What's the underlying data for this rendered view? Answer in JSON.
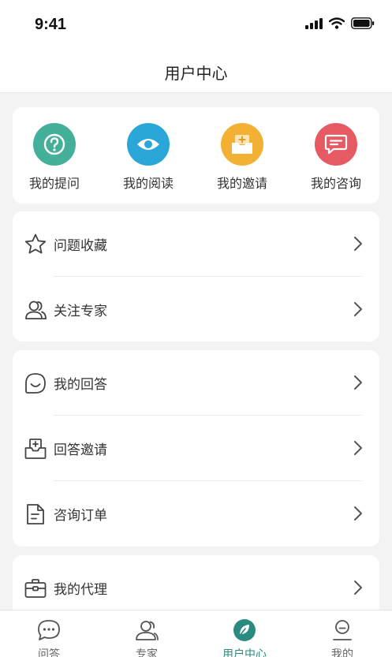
{
  "status_bar": {
    "time": "9:41"
  },
  "header": {
    "title": "用户中心"
  },
  "quick_actions": [
    {
      "label": "我的提问",
      "icon": "question-icon",
      "color": "#45b09a"
    },
    {
      "label": "我的阅读",
      "icon": "eye-icon",
      "color": "#2aa6d8"
    },
    {
      "label": "我的邀请",
      "icon": "invite-box-icon",
      "color": "#f2b134"
    },
    {
      "label": "我的咨询",
      "icon": "chat-bubble-icon",
      "color": "#e65a63"
    }
  ],
  "menu_groups": [
    {
      "items": [
        {
          "label": "问题收藏",
          "icon": "star-icon"
        },
        {
          "label": "关注专家",
          "icon": "users-icon"
        }
      ]
    },
    {
      "items": [
        {
          "label": "我的回答",
          "icon": "smile-bubble-icon"
        },
        {
          "label": "回答邀请",
          "icon": "inbox-plus-icon"
        },
        {
          "label": "咨询订单",
          "icon": "document-icon"
        }
      ]
    },
    {
      "items": [
        {
          "label": "我的代理",
          "icon": "briefcase-icon"
        }
      ]
    }
  ],
  "tab_bar": {
    "active_color": "#2b8a80",
    "items": [
      {
        "label": "问答",
        "icon": "chat-icon",
        "active": false
      },
      {
        "label": "专家",
        "icon": "expert-icon",
        "active": false
      },
      {
        "label": "用户中心",
        "icon": "leaf-icon",
        "active": true
      },
      {
        "label": "我的",
        "icon": "profile-icon",
        "active": false
      }
    ]
  }
}
